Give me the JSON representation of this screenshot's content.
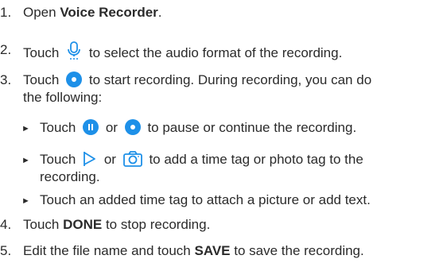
{
  "steps": [
    {
      "num": "1.",
      "pre": "Open ",
      "bold": "Voice Recorder",
      "post": "."
    },
    {
      "num": "2.",
      "pre": "Touch",
      "post": "to select the audio format of the recording."
    },
    {
      "num": "3.",
      "pre": "Touch",
      "post": "to start recording. During recording, you can do",
      "cont": "the following:"
    },
    {
      "num": "4.",
      "pre": "Touch ",
      "bold": "DONE",
      "post": " to stop recording."
    },
    {
      "num": "5.",
      "pre": "Edit the file name and touch ",
      "bold": "SAVE",
      "post": " to save the recording."
    }
  ],
  "substeps": [
    {
      "bullet": "►",
      "pre": "Touch",
      "mid": "or",
      "post": "to pause or continue the recording."
    },
    {
      "bullet": "►",
      "pre": "Touch",
      "mid": "or",
      "post": "to add a time tag or photo tag to the",
      "cont": "recording."
    },
    {
      "bullet": "►",
      "text": "Touch an added time tag to attach a picture or add text."
    }
  ],
  "icons": {
    "mic": "microphone-icon",
    "record": "record-icon",
    "pause": "pause-icon",
    "resume": "record-icon",
    "flag": "flag-icon",
    "camera": "camera-icon"
  },
  "colors": {
    "accent": "#1e90e8",
    "text": "#2b2b2b"
  }
}
